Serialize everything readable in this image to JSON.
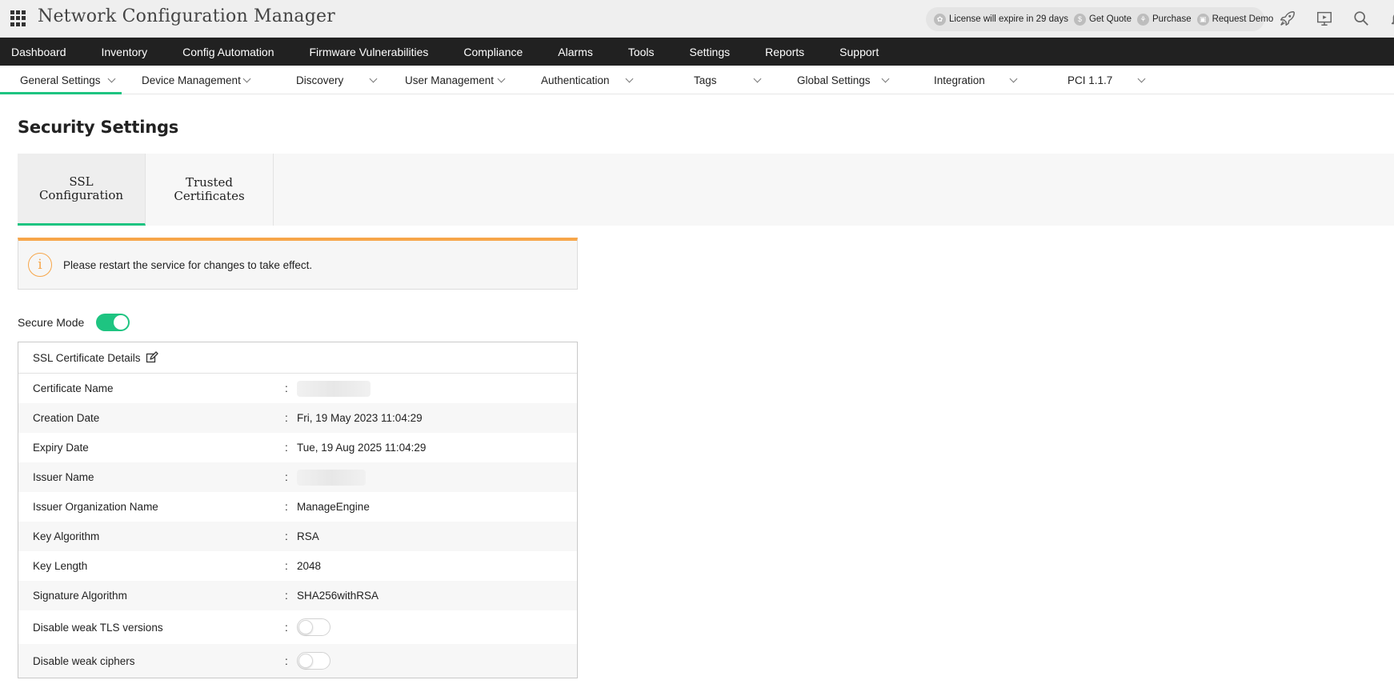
{
  "app": {
    "title": "Network Configuration Manager"
  },
  "license": [
    {
      "label": "License will expire in 29 days",
      "icon": "license-icon"
    },
    {
      "label": "Get Quote",
      "icon": "dollar-icon"
    },
    {
      "label": "Purchase",
      "icon": "cart-icon"
    },
    {
      "label": "Request Demo",
      "icon": "demo-icon"
    }
  ],
  "main_nav": [
    "Dashboard",
    "Inventory",
    "Config Automation",
    "Firmware Vulnerabilities",
    "Compliance",
    "Alarms",
    "Tools",
    "Settings",
    "Reports",
    "Support"
  ],
  "sub_nav": [
    "General Settings",
    "Device Management",
    "Discovery",
    "User Management",
    "Authentication",
    "Tags",
    "Global Settings",
    "Integration",
    "PCI 1.1.7"
  ],
  "page": {
    "title": "Security Settings"
  },
  "tabs": [
    {
      "line1": "SSL",
      "line2": "Configuration"
    },
    {
      "line1": "Trusted",
      "line2": "Certificates"
    }
  ],
  "alert": {
    "text": "Please restart the service for changes to take effect."
  },
  "secure_mode": {
    "label": "Secure Mode",
    "enabled": true
  },
  "cert": {
    "header": "SSL Certificate Details",
    "separator": ":",
    "rows": [
      {
        "label": "Certificate Name",
        "value": ""
      },
      {
        "label": "Creation Date",
        "value": "Fri, 19 May 2023 11:04:29"
      },
      {
        "label": "Expiry Date",
        "value": "Tue, 19 Aug 2025 11:04:29"
      },
      {
        "label": "Issuer Name",
        "value": ""
      },
      {
        "label": "Issuer Organization Name",
        "value": "ManageEngine"
      },
      {
        "label": "Key Algorithm",
        "value": "RSA"
      },
      {
        "label": "Key Length",
        "value": "2048"
      },
      {
        "label": "Signature Algorithm",
        "value": "SHA256withRSA"
      },
      {
        "label": "Disable weak TLS versions",
        "value": ""
      },
      {
        "label": "Disable weak ciphers",
        "value": ""
      }
    ],
    "toggles": {
      "weak_tls": false,
      "weak_ciphers": false
    }
  },
  "colors": {
    "accent": "#1ec481",
    "warning": "#f7a64a",
    "nav_bg": "#212121"
  }
}
